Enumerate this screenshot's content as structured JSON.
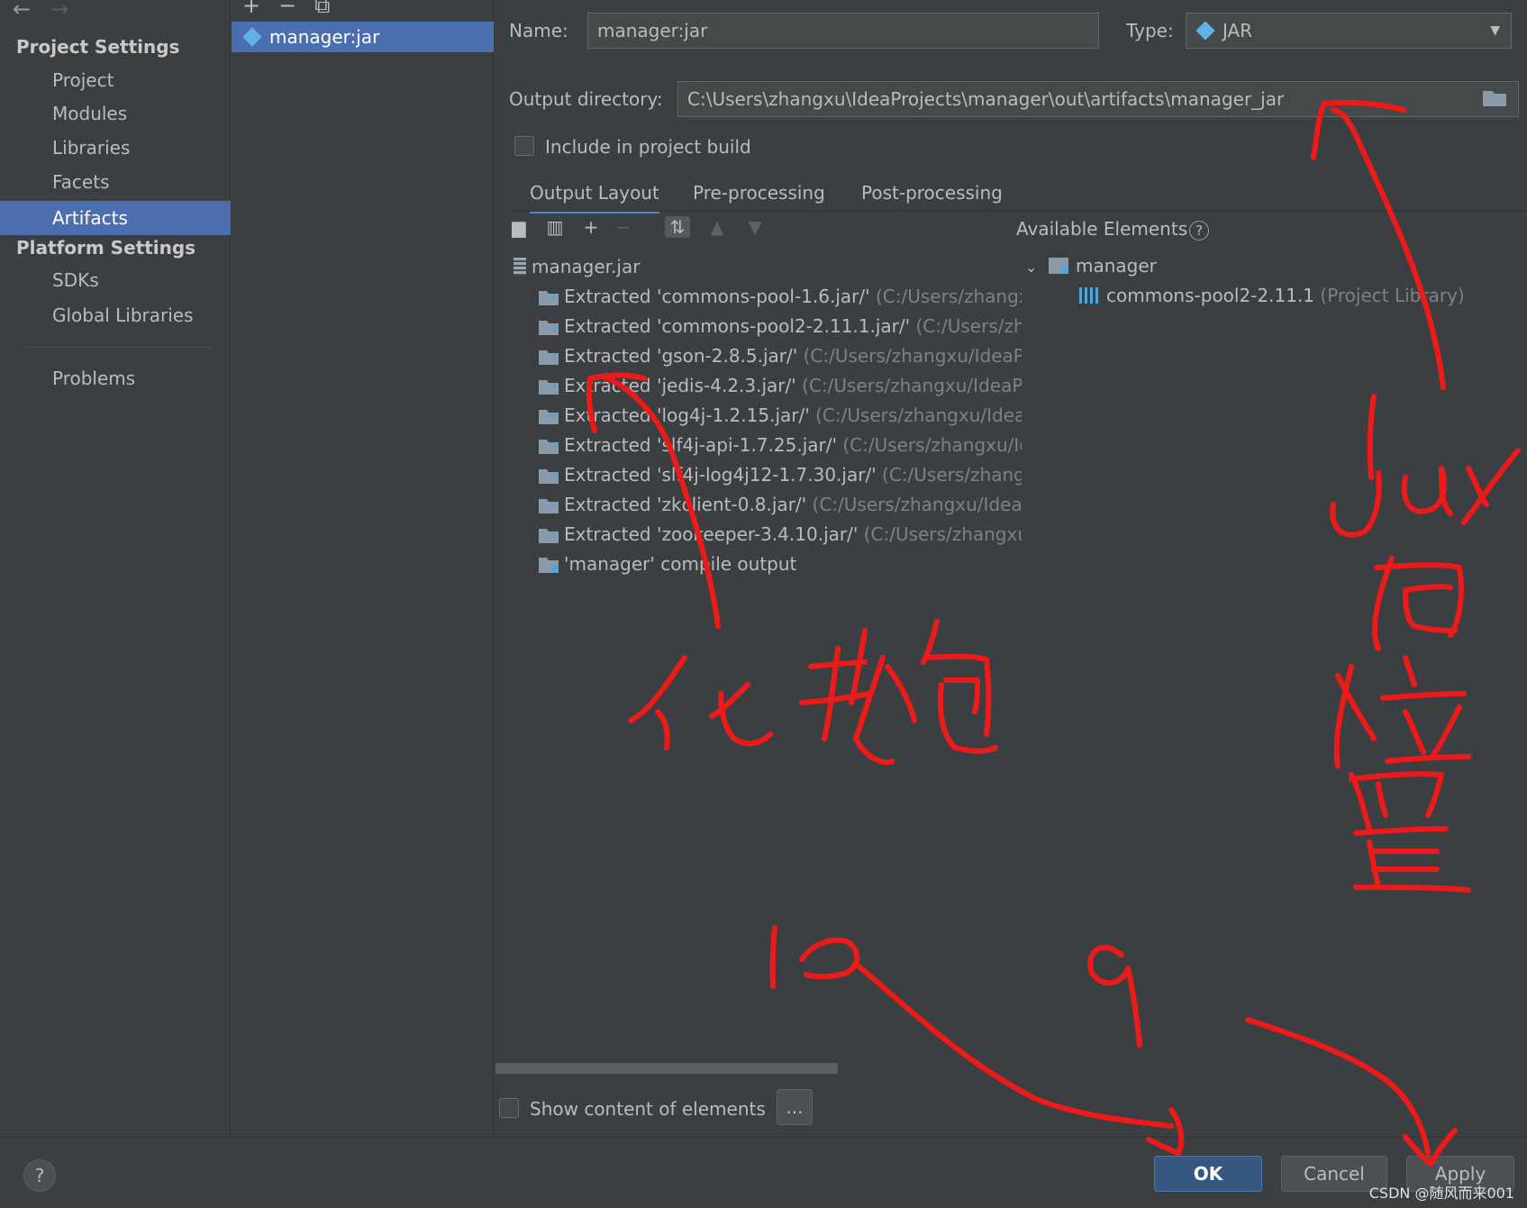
{
  "nav": {
    "back_icon": "arrow-left-icon",
    "forward_icon": "arrow-right-icon",
    "project_settings": "Project Settings",
    "project_items": [
      "Project",
      "Modules",
      "Libraries",
      "Facets",
      "Artifacts"
    ],
    "platform_settings": "Platform Settings",
    "platform_items": [
      "SDKs",
      "Global Libraries"
    ],
    "problems": "Problems"
  },
  "artifacts": {
    "toolbar": [
      "+",
      "−",
      "⧉"
    ],
    "selected": "manager:jar"
  },
  "form": {
    "name_label": "Name:",
    "name_value": "manager:jar",
    "type_label": "Type:",
    "type_value": "JAR",
    "output_label": "Output directory:",
    "output_value": "C:\\Users\\zhangxu\\IdeaProjects\\manager\\out\\artifacts\\manager_jar",
    "include_label": "Include in project build",
    "include_checked": false
  },
  "tabs": [
    "Output Layout",
    "Pre-processing",
    "Post-processing"
  ],
  "layout": {
    "root": "manager.jar",
    "rows": [
      {
        "name": "Extracted 'commons-pool-1.6.jar/'",
        "path": "(C:/Users/zhangxu/"
      },
      {
        "name": "Extracted 'commons-pool2-2.11.1.jar/'",
        "path": "(C:/Users/zhan"
      },
      {
        "name": "Extracted 'gson-2.8.5.jar/'",
        "path": "(C:/Users/zhangxu/IdeaProj"
      },
      {
        "name": "Extracted 'jedis-4.2.3.jar/'",
        "path": "(C:/Users/zhangxu/IdeaProj"
      },
      {
        "name": "Extracted 'log4j-1.2.15.jar/'",
        "path": "(C:/Users/zhangxu/IdeaProjects/manager/lib)"
      },
      {
        "name": "Extracted 'slf4j-api-1.7.25.jar/'",
        "path": "(C:/Users/zhangxu/Idea"
      },
      {
        "name": "Extracted 'slf4j-log4j12-1.7.30.jar/'",
        "path": "(C:/Users/zhangxu/"
      },
      {
        "name": "Extracted 'zkclient-0.8.jar/'",
        "path": "(C:/Users/zhangxu/IdeaPro"
      },
      {
        "name": "Extracted 'zookeeper-3.4.10.jar/'",
        "path": "(C:/Users/zhangxu/Id"
      }
    ],
    "compile_output": "'manager' compile output"
  },
  "available": {
    "title": "Available Elements",
    "help": "?",
    "module": "manager",
    "library": "commons-pool2-2.11.1",
    "library_note": "(Project Library)"
  },
  "show_content_label": "Show content of elements",
  "ellipsis": "...",
  "buttons": {
    "ok": "OK",
    "cancel": "Cancel",
    "apply": "Apply"
  },
  "help_button": "?",
  "watermark": "CSDN @随风而来001",
  "accent": "#4b6eaf",
  "ink_color": "#ee1a1a"
}
